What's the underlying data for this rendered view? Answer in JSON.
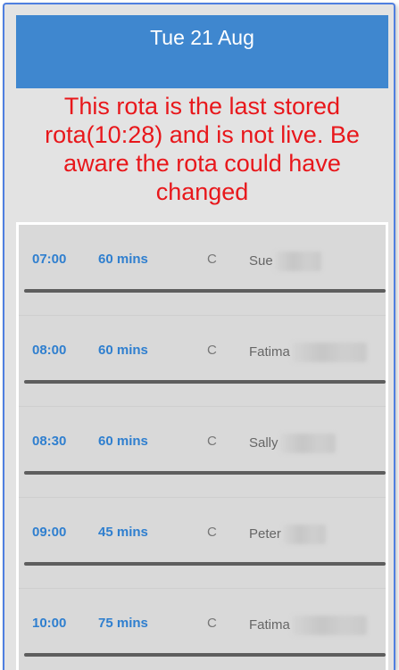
{
  "header": {
    "title": "Tue 21 Aug"
  },
  "warning": {
    "text": "This rota is the last stored rota(10:28) and is not live. Be aware the rota could have changed",
    "color": "#e8171b"
  },
  "colors": {
    "header_bg": "#3f87cf",
    "accent_text": "#2f7fcf",
    "frame_border": "#4f7fe0"
  },
  "rota": [
    {
      "time": "07:00",
      "duration": "60 mins",
      "code": "C",
      "name": "Sue"
    },
    {
      "time": "08:00",
      "duration": "60 mins",
      "code": "C",
      "name": "Fatima"
    },
    {
      "time": "08:30",
      "duration": "60 mins",
      "code": "C",
      "name": "Sally"
    },
    {
      "time": "09:00",
      "duration": "45 mins",
      "code": "C",
      "name": "Peter"
    },
    {
      "time": "10:00",
      "duration": "75 mins",
      "code": "C",
      "name": "Fatima"
    }
  ]
}
